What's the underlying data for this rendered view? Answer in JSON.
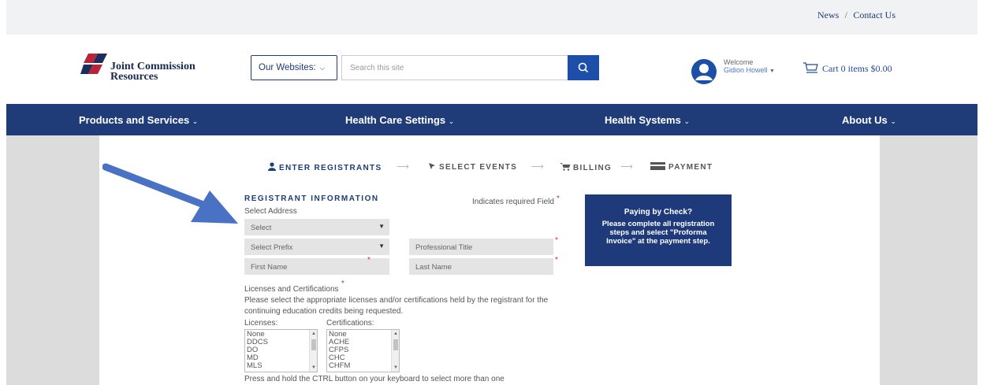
{
  "topbar": {
    "news": "News",
    "separator": "/",
    "contact": "Contact Us"
  },
  "header": {
    "logo_line1": "Joint Commission",
    "logo_line2": "Resources",
    "websites_label": "Our Websites:",
    "search_placeholder": "Search this site",
    "welcome_label": "Welcome",
    "user_name": "Gidion Howell",
    "cart_text": "Cart 0 items $0.00"
  },
  "nav": {
    "items": [
      {
        "label": "Products and Services"
      },
      {
        "label": "Health Care Settings"
      },
      {
        "label": "Health Systems"
      },
      {
        "label": "About Us"
      }
    ]
  },
  "steps": [
    {
      "label": "ENTER REGISTRANTS",
      "icon": "user-icon"
    },
    {
      "label": "SELECT EVENTS",
      "icon": "pointer-icon"
    },
    {
      "label": "BILLING",
      "icon": "cart-icon"
    },
    {
      "label": "PAYMENT",
      "icon": "card-icon"
    }
  ],
  "form": {
    "section_title": "REGISTRANT INFORMATION",
    "required_note": "Indicates required Field",
    "select_address_label": "Select Address",
    "address_select": "Select",
    "prefix_select": "Select Prefix",
    "professional_title": "Professional Title",
    "first_name": "First Name",
    "last_name": "Last Name",
    "licenses_title": "Licenses and Certifications",
    "licenses_desc1": "Please select the appropriate licenses and/or certifications held by the registrant for the",
    "licenses_desc2": "continuing education credits being requested.",
    "licenses_label": "Licenses:",
    "certifications_label": "Certifications:",
    "licenses": [
      "None",
      "DDCS",
      "DO",
      "MD",
      "MLS"
    ],
    "certifications": [
      "None",
      "ACHE",
      "CFPS",
      "CHC",
      "CHFM"
    ],
    "ctrl_hint": "Press and hold the CTRL button on your keyboard to select more than one"
  },
  "infobox": {
    "heading": "Paying by Check?",
    "line1": "Please complete all registration",
    "line2": "steps and select \"Proforma",
    "line3": "Invoice\" at the payment step."
  },
  "colors": {
    "navy": "#203c78",
    "accent": "#1e4fa8",
    "arrow": "#4a72c4",
    "required": "#cc3333"
  }
}
